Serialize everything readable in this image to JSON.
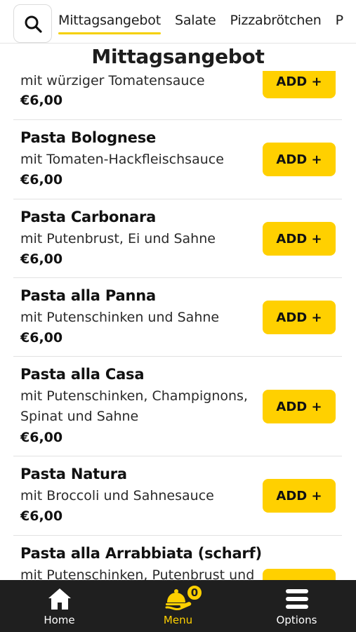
{
  "tabs": [
    {
      "label": "Mittagsangebot",
      "active": true
    },
    {
      "label": "Salate",
      "active": false
    },
    {
      "label": "Pizzabrötchen",
      "active": false
    },
    {
      "label": "P",
      "active": false
    }
  ],
  "section_title": "Mittagsangebot",
  "add_label": "ADD +",
  "items": [
    {
      "name": "",
      "desc": "mit würziger Tomatensauce",
      "price": "€6,00"
    },
    {
      "name": "Pasta Bolognese",
      "desc": "mit Tomaten-Hackfleischsauce",
      "price": "€6,00"
    },
    {
      "name": "Pasta Carbonara",
      "desc": "mit Putenbrust, Ei und Sahne",
      "price": "€6,00"
    },
    {
      "name": "Pasta alla Panna",
      "desc": "mit Putenschinken und Sahne",
      "price": "€6,00"
    },
    {
      "name": "Pasta alla Casa",
      "desc": "mit Putenschinken, Champignons, Spinat und Sahne",
      "price": "€6,00"
    },
    {
      "name": "Pasta Natura",
      "desc": "mit Broccoli und Sahnesauce",
      "price": "€6,00"
    },
    {
      "name": "Pasta alla Arrabbiata (scharf)",
      "desc": "mit Putenschinken, Putenbrust und",
      "price": ""
    }
  ],
  "nav": {
    "home": "Home",
    "menu": "Menu",
    "options": "Options",
    "cart_count": "0"
  },
  "colors": {
    "accent": "#ffd000",
    "nav_bg": "#1f1f1f"
  },
  "icons": [
    "search-icon",
    "home-icon",
    "cloche-icon",
    "menu-lines-icon"
  ]
}
